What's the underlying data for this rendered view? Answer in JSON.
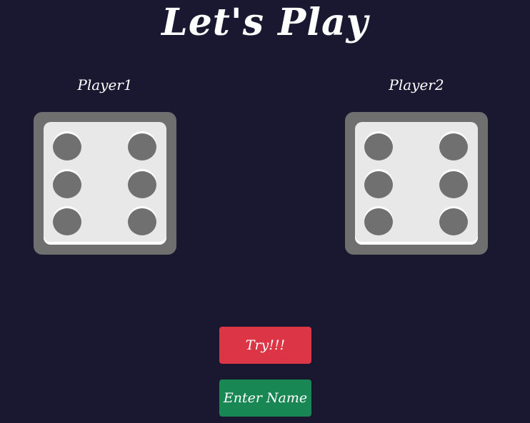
{
  "title": "Let's Play",
  "players": [
    {
      "name": "Player1",
      "die_value": 6
    },
    {
      "name": "Player2",
      "die_value": 6
    }
  ],
  "buttons": {
    "try_label": "Try!!!",
    "enter_name_label": "Enter Name"
  },
  "colors": {
    "background": "#1a1830",
    "die_frame": "#6f6f6f",
    "die_face": "#e8e8e8",
    "pip": "#707070",
    "try_button": "#dc3545",
    "enter_name_button": "#198754"
  }
}
